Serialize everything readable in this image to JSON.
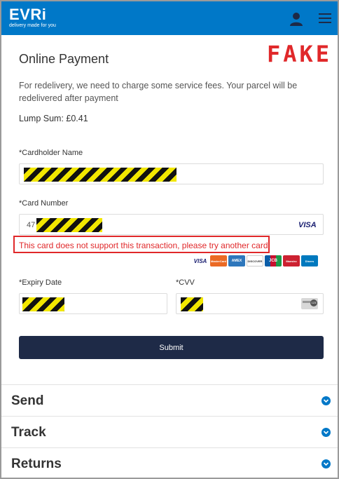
{
  "header": {
    "logo_word": "EVRi",
    "logo_tagline": "delivery made for you",
    "account_icon": "user-icon",
    "menu_icon": "hamburger-menu-icon",
    "brand_color": "#0078c8"
  },
  "watermark": "FAKE",
  "page": {
    "title": "Online Payment",
    "description": "For redelivery, we need to charge some service fees. Your parcel will be redelivered after payment",
    "lump_sum": "Lump Sum: £0.41"
  },
  "form": {
    "cardholder_label": "*Cardholder Name",
    "card_number_label": "*Card Number",
    "card_number_prefix": "47",
    "card_brand": "VISA",
    "error": "This card does not support this transaction, please try another card",
    "accepted_cards": [
      "VISA",
      "MasterCard",
      "AMEX",
      "DISCOVER",
      "JCB",
      "Maestro",
      "Diners"
    ],
    "expiry_label": "*Expiry Date",
    "cvv_label": "*CVV",
    "cvv_icon_text": "123",
    "submit_label": "Submit",
    "error_color": "#e0282a",
    "submit_color": "#1e2a47"
  },
  "accordion": [
    {
      "label": "Send"
    },
    {
      "label": "Track"
    },
    {
      "label": "Returns"
    }
  ]
}
